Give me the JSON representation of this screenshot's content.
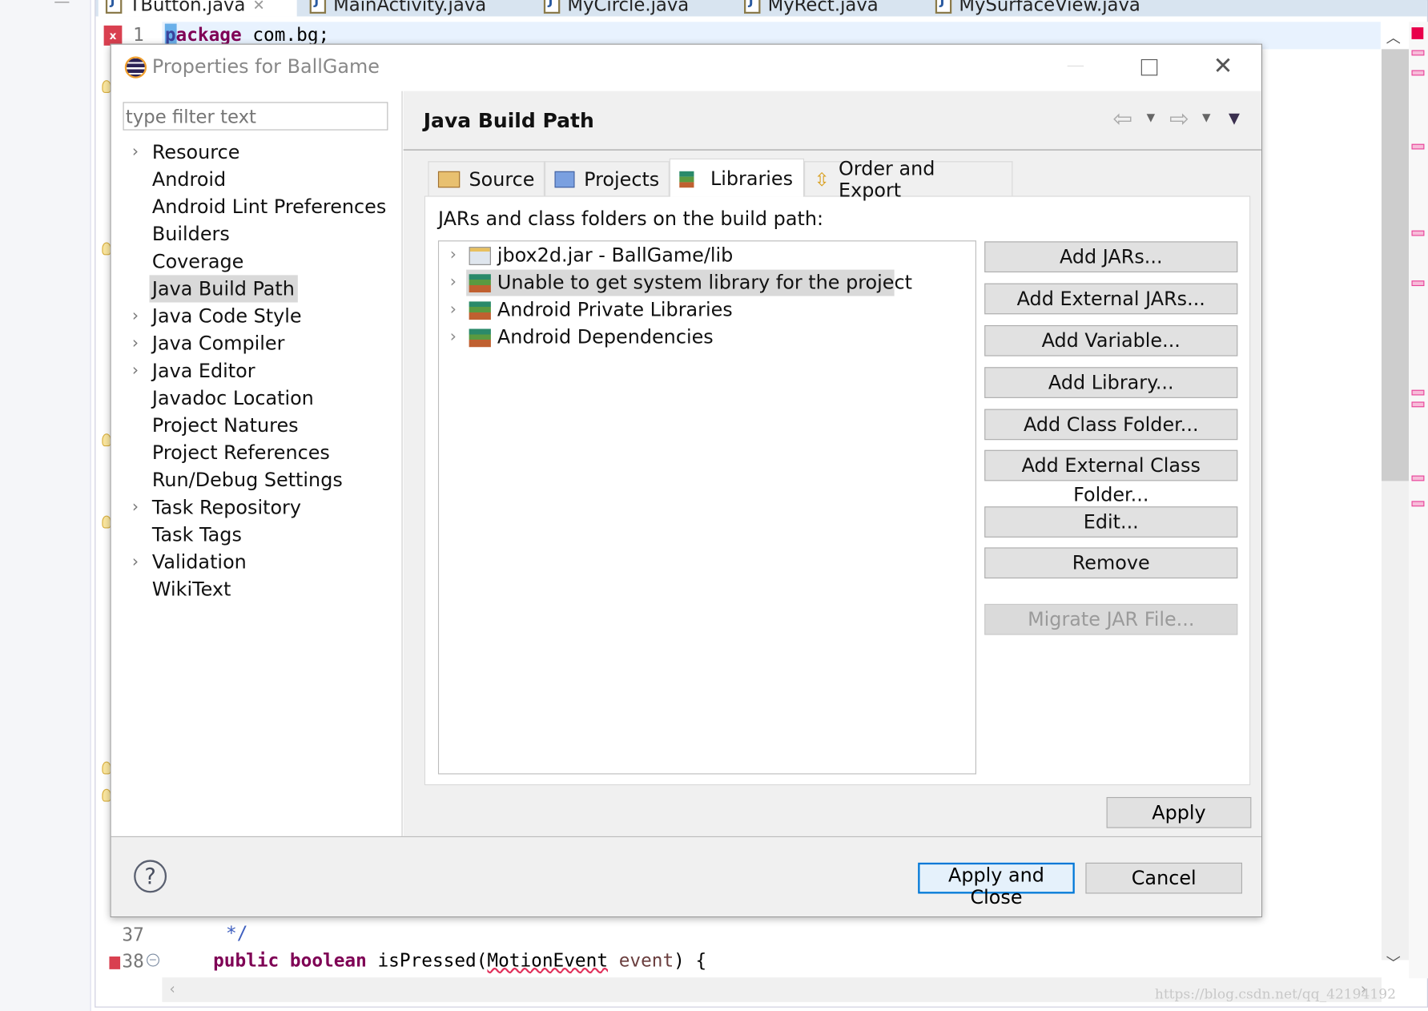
{
  "editor": {
    "tabs": [
      {
        "label": "TButton.java",
        "active": true
      },
      {
        "label": "MainActivity.java"
      },
      {
        "label": "MyCircle.java"
      },
      {
        "label": "MyRect.java"
      },
      {
        "label": "MySurfaceView.java"
      }
    ],
    "lines": [
      {
        "num": "1",
        "keyword": "package",
        "rest": " com.bg;"
      },
      {
        "num": "37",
        "text": " */"
      },
      {
        "num": "38",
        "kw1": "public",
        "kw2": "boolean",
        "name": " isPressed(",
        "type": "MotionEvent",
        "param": " event",
        "end": ") {"
      }
    ],
    "watermark": "https://blog.csdn.net/qq_42194192"
  },
  "dialog": {
    "title": "Properties for BallGame",
    "filter_placeholder": "type filter text",
    "tree": [
      {
        "label": "Resource",
        "expandable": true
      },
      {
        "label": "Android"
      },
      {
        "label": "Android Lint Preferences"
      },
      {
        "label": "Builders"
      },
      {
        "label": "Coverage"
      },
      {
        "label": "Java Build Path",
        "selected": true
      },
      {
        "label": "Java Code Style",
        "expandable": true
      },
      {
        "label": "Java Compiler",
        "expandable": true
      },
      {
        "label": "Java Editor",
        "expandable": true
      },
      {
        "label": "Javadoc Location"
      },
      {
        "label": "Project Natures"
      },
      {
        "label": "Project References"
      },
      {
        "label": "Run/Debug Settings"
      },
      {
        "label": "Task Repository",
        "expandable": true
      },
      {
        "label": "Task Tags"
      },
      {
        "label": "Validation",
        "expandable": true
      },
      {
        "label": "WikiText"
      }
    ],
    "page_title": "Java Build Path",
    "tabs": [
      {
        "label": "Source"
      },
      {
        "label": "Projects"
      },
      {
        "label": "Libraries",
        "selected": true
      },
      {
        "label": "Order and Export"
      }
    ],
    "list_label": "JARs and class folders on the build path:",
    "libraries": [
      {
        "label": "jbox2d.jar - BallGame/lib",
        "icon": "jar-icon"
      },
      {
        "label": "Unable to get system library for the project",
        "icon": "library-icon",
        "selected": true
      },
      {
        "label": "Android Private Libraries",
        "icon": "library-icon"
      },
      {
        "label": "Android Dependencies",
        "icon": "library-icon"
      }
    ],
    "buttons": [
      {
        "label": "Add JARs..."
      },
      {
        "label": "Add External JARs..."
      },
      {
        "label": "Add Variable..."
      },
      {
        "label": "Add Library..."
      },
      {
        "label": "Add Class Folder..."
      },
      {
        "label": "Add External Class Folder..."
      },
      {
        "label": "Edit..."
      },
      {
        "label": "Remove"
      },
      {
        "label": "Migrate JAR File...",
        "disabled": true
      }
    ],
    "apply": "Apply",
    "apply_close": "Apply and Close",
    "cancel": "Cancel",
    "help_glyph": "?"
  },
  "colors": {
    "accent": "#0078d7",
    "keyword": "#7f0055",
    "selection": "#d9d9d9"
  }
}
